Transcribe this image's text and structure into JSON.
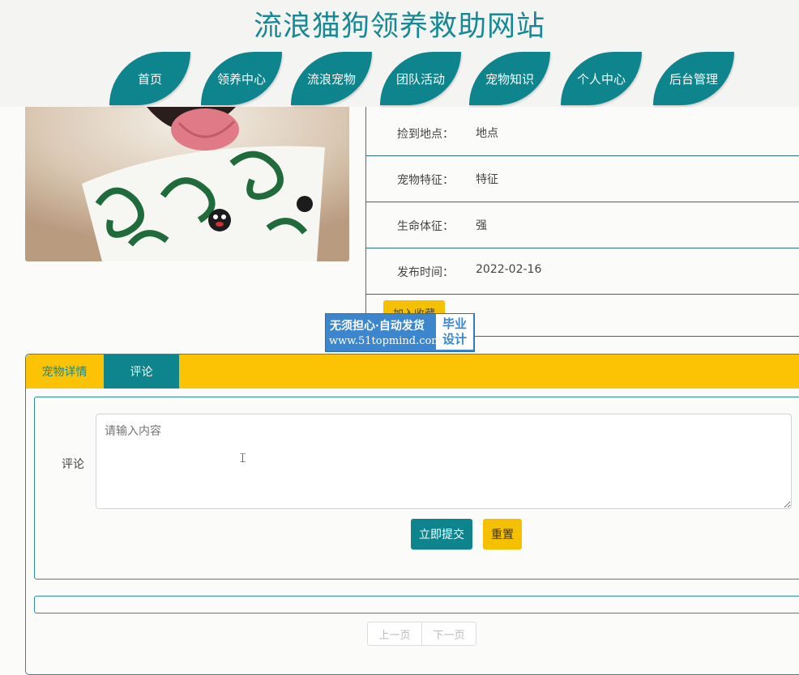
{
  "site": {
    "title": "流浪猫狗领养救助网站"
  },
  "nav": [
    {
      "label": "首页"
    },
    {
      "label": "领养中心"
    },
    {
      "label": "流浪宠物"
    },
    {
      "label": "团队活动"
    },
    {
      "label": "宠物知识"
    },
    {
      "label": "个人中心"
    },
    {
      "label": "后台管理"
    }
  ],
  "details": [
    {
      "label": "捡到地点：",
      "value": "地点"
    },
    {
      "label": "宠物特征：",
      "value": "特征"
    },
    {
      "label": "生命体征：",
      "value": "强"
    },
    {
      "label": "发布时间：",
      "value": "2022-02-16"
    }
  ],
  "favorite_button": "加入收藏",
  "watermark": {
    "line1": "无须担心·自动发货",
    "line2": "www.51topmind.com",
    "box_line1": "毕业",
    "box_line2": "设计"
  },
  "tabs": [
    {
      "label": "宠物详情"
    },
    {
      "label": "评论"
    }
  ],
  "comment": {
    "label": "评论",
    "placeholder": "请输入内容",
    "submit_label": "立即提交",
    "reset_label": "重置"
  },
  "pager": {
    "prev_label": "上一页",
    "next_label": "下一页"
  },
  "colors": {
    "primary": "#0e848c",
    "accent": "#f5c000",
    "title": "#168994"
  }
}
